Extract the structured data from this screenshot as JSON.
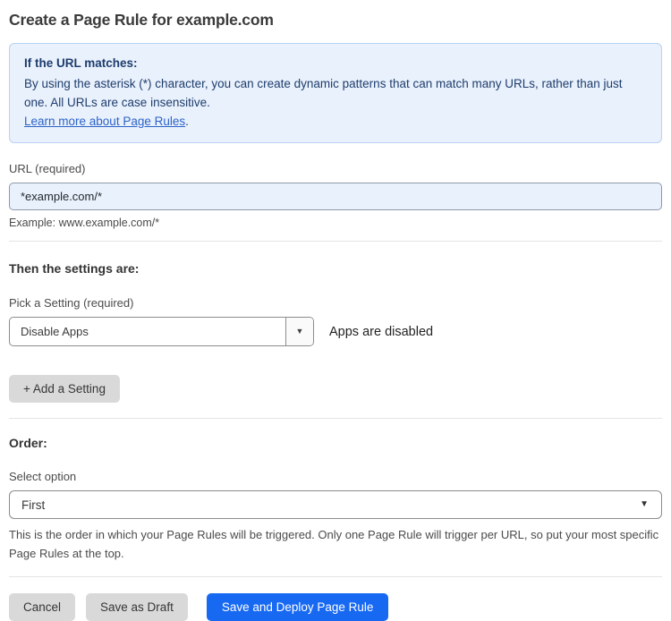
{
  "page": {
    "title": "Create a Page Rule for example.com"
  },
  "info_box": {
    "heading": "If the URL matches:",
    "body": "By using the asterisk (*) character, you can create dynamic patterns that can match many URLs, rather than just one. All URLs are case insensitive.",
    "link_label": "Learn more about Page Rules",
    "link_suffix": "."
  },
  "url_field": {
    "label": "URL (required)",
    "value": "*example.com/*",
    "helper": "Example: www.example.com/*"
  },
  "settings_section": {
    "heading": "Then the settings are:",
    "setting_label": "Pick a Setting (required)",
    "setting_value": "Disable Apps",
    "setting_status": "Apps are disabled",
    "add_setting_label": "+ Add a Setting",
    "dropdown_arrow": "▼"
  },
  "order_section": {
    "heading": "Order:",
    "label": "Select option",
    "value": "First",
    "dropdown_arrow": "▼",
    "helper": "This is the order in which your Page Rules will be triggered. Only one Page Rule will trigger per URL, so put your most specific Page Rules at the top."
  },
  "actions": {
    "cancel": "Cancel",
    "save_draft": "Save as Draft",
    "save_deploy": "Save and Deploy Page Rule"
  },
  "colors": {
    "primary_button_blue": "#1769f2",
    "info_box_background": "#e9f1fc",
    "info_box_border": "#b9d3f0",
    "info_text_navy": "#1e3d6d",
    "link_blue": "#2d63c8",
    "input_background": "#e9f1fc",
    "gray_button": "#d9d9d9"
  }
}
